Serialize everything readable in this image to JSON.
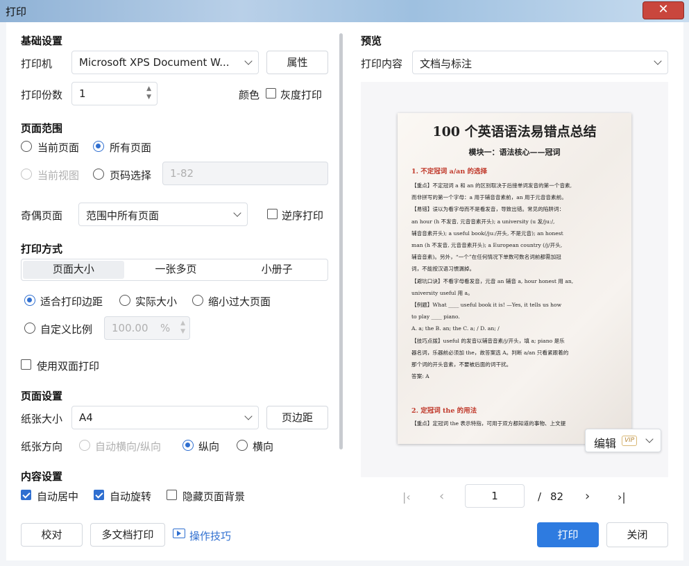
{
  "window": {
    "title": "打印",
    "close_icon": "✕"
  },
  "basic": {
    "heading": "基础设置",
    "printer_label": "打印机",
    "printer_value": "Microsoft XPS Document W...",
    "properties_btn": "属性",
    "copies_label": "打印份数",
    "copies_value": "1",
    "color_label": "颜色",
    "grayscale_label": "灰度打印"
  },
  "range": {
    "heading": "页面范围",
    "current_page": "当前页面",
    "all_pages": "所有页面",
    "current_view": "当前视图",
    "page_select": "页码选择",
    "page_range_placeholder": "1-82",
    "odd_even_label": "奇偶页面",
    "odd_even_value": "范围中所有页面",
    "reverse_label": "逆序打印"
  },
  "method": {
    "heading": "打印方式",
    "tabs": [
      "页面大小",
      "一张多页",
      "小册子"
    ],
    "fit_margin": "适合打印边距",
    "actual_size": "实际大小",
    "shrink_large": "缩小过大页面",
    "custom_scale": "自定义比例",
    "scale_value": "100.00",
    "scale_unit": "%",
    "duplex_label": "使用双面打印"
  },
  "page_setup": {
    "heading": "页面设置",
    "paper_size_label": "纸张大小",
    "paper_size_value": "A4",
    "margins_btn": "页边距",
    "orientation_label": "纸张方向",
    "auto_orient": "自动横向/纵向",
    "portrait": "纵向",
    "landscape": "横向"
  },
  "content": {
    "heading": "内容设置",
    "auto_center": "自动居中",
    "auto_rotate": "自动旋转",
    "hide_bg": "隐藏页面背景"
  },
  "footer": {
    "proof_btn": "校对",
    "multi_doc_btn": "多文档打印",
    "tips_link": "操作技巧",
    "print_btn": "打印",
    "close_btn": "关闭"
  },
  "preview": {
    "heading": "预览",
    "print_content_label": "打印内容",
    "print_content_value": "文档与标注",
    "edit_btn": "编辑",
    "vip_badge": "VIP",
    "page_current": "1",
    "page_separator": "/",
    "page_total": "82",
    "doc": {
      "title": "100 个英语语法易错点总结",
      "subtitle": "模块一：语法核心——冠词",
      "h1": "1. 不定冠词 a/an 的选择",
      "lines": [
        "【重点】不定冠词 a 和 an 的区别取决于后接单词发音的第一个音素,",
        "而非拼写的第一个字母：a 用于辅音音素前，an 用于元音音素前。",
        "【易错】误以为看字母而不是看发音，导致出错。常见的陷阱词：",
        "an hour (h 不发音, 元音音素开头); a university (u 发/ju:/,",
        "辅音音素开头); a useful book(/ju:/开头, 不是元音); an honest",
        "man (h 不发音, 元音音素开头); a European country (/j/开头,",
        "辅音音素)。另外，“一个”在任何情况下单数可数名词前都需加冠",
        "词，不能按汉语习惯漏掉。",
        "【避坑口诀】不看字母看发音，元音 an 辅音 a, hour honest 用 an,",
        "university useful 用 a。",
        "【例题】What ____ useful book it is! —Yes, it tells us how",
        "to play ____ piano.",
        "A. a; the  B. an; the  C. a; /  D. an; /",
        "【技巧点拨】useful 的发音以辅音音素/j/开头，填 a; piano 是乐",
        "器名词，乐器前必须加 the，故答案选 A。判断 a/an 只看紧跟着的",
        "那个词的开头音素，不要被后面的词干扰。",
        "答案: A"
      ],
      "h2": "2. 定冠词 the 的用法",
      "last_line": "【重点】定冠词 the 表示特指，可用于双方都知道的事物、上文提"
    }
  }
}
